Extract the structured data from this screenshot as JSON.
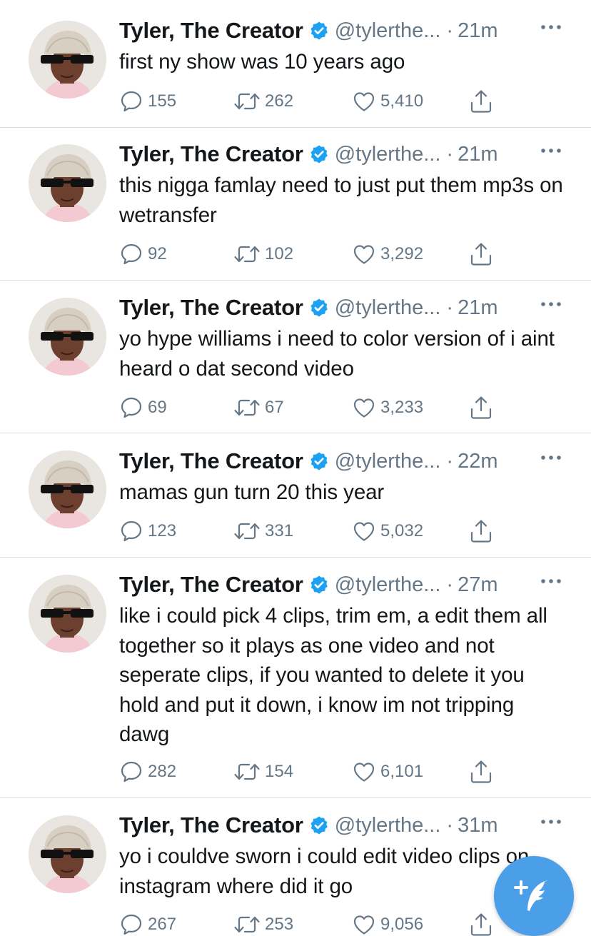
{
  "colors": {
    "accent": "#1da1f2",
    "fab": "#4a9fe8",
    "secondary_text": "#657786",
    "primary_text": "#14171a",
    "divider": "#dcdfe2"
  },
  "icons": {
    "reply": "reply-icon",
    "retweet": "retweet-icon",
    "like": "like-icon",
    "share": "share-icon",
    "more": "more-icon",
    "verified": "verified-badge-icon",
    "compose": "compose-tweet-icon"
  },
  "tweets": [
    {
      "name": "Tyler, The Creator",
      "handle": "@tylerthe...",
      "separator": "·",
      "time": "21m",
      "text": "first ny show was 10 years ago",
      "replies": "155",
      "retweets": "262",
      "likes": "5,410"
    },
    {
      "name": "Tyler, The Creator",
      "handle": "@tylerthe...",
      "separator": "·",
      "time": "21m",
      "text": "this nigga famlay need to just put them mp3s on wetransfer",
      "replies": "92",
      "retweets": "102",
      "likes": "3,292"
    },
    {
      "name": "Tyler, The Creator",
      "handle": "@tylerthe...",
      "separator": "·",
      "time": "21m",
      "text": "yo hype williams i need to color version of i aint heard o dat second video",
      "replies": "69",
      "retweets": "67",
      "likes": "3,233"
    },
    {
      "name": "Tyler, The Creator",
      "handle": "@tylerthe...",
      "separator": "·",
      "time": "22m",
      "text": "mamas gun turn 20 this year",
      "replies": "123",
      "retweets": "331",
      "likes": "5,032"
    },
    {
      "name": "Tyler, The Creator",
      "handle": "@tylerthe...",
      "separator": "·",
      "time": "27m",
      "text": "like i could pick 4 clips, trim em, a edit them all together so it plays as one video and not seperate clips, if you wanted to delete it you hold and put it down, i know im not tripping dawg",
      "replies": "282",
      "retweets": "154",
      "likes": "6,101"
    },
    {
      "name": "Tyler, The Creator",
      "handle": "@tylerthe...",
      "separator": "·",
      "time": "31m",
      "text": "yo i couldve sworn i could edit video clips on instagram where did it go",
      "replies": "267",
      "retweets": "253",
      "likes": "9,056"
    }
  ]
}
